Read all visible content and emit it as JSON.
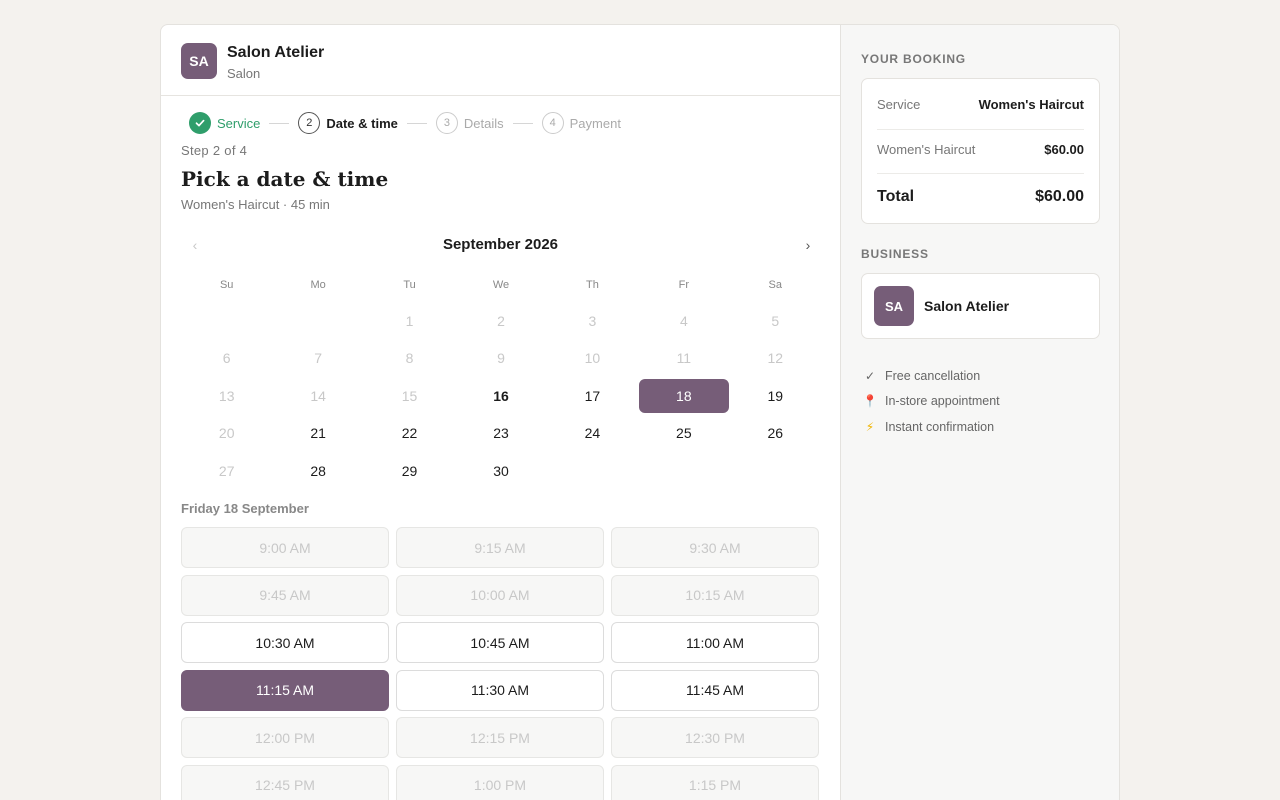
{
  "business": {
    "initials": "SA",
    "name": "Salon Atelier",
    "category": "Salon"
  },
  "stepper": {
    "steps": [
      {
        "number": "",
        "label": "Service",
        "status": "done"
      },
      {
        "number": "2",
        "label": "Date & time",
        "status": "active"
      },
      {
        "number": "3",
        "label": "Details",
        "status": "todo"
      },
      {
        "number": "4",
        "label": "Payment",
        "status": "todo"
      }
    ]
  },
  "page": {
    "step_count": "Step 2 of 4",
    "title": "Pick a date & time",
    "subtitle": "Women's Haircut · 45 min"
  },
  "calendar": {
    "month_title": "September 2026",
    "prev_icon": "‹",
    "next_icon": "›",
    "weekdays": [
      "Su",
      "Mo",
      "Tu",
      "We",
      "Th",
      "Fr",
      "Sa"
    ],
    "days": [
      {
        "label": "",
        "state": "empty"
      },
      {
        "label": "",
        "state": "empty"
      },
      {
        "label": "1",
        "state": "past"
      },
      {
        "label": "2",
        "state": "past"
      },
      {
        "label": "3",
        "state": "past"
      },
      {
        "label": "4",
        "state": "past"
      },
      {
        "label": "5",
        "state": "past"
      },
      {
        "label": "6",
        "state": "past"
      },
      {
        "label": "7",
        "state": "past"
      },
      {
        "label": "8",
        "state": "past"
      },
      {
        "label": "9",
        "state": "past"
      },
      {
        "label": "10",
        "state": "past"
      },
      {
        "label": "11",
        "state": "past"
      },
      {
        "label": "12",
        "state": "past"
      },
      {
        "label": "13",
        "state": "past"
      },
      {
        "label": "14",
        "state": "past"
      },
      {
        "label": "15",
        "state": "past"
      },
      {
        "label": "16",
        "state": "today"
      },
      {
        "label": "17",
        "state": "available"
      },
      {
        "label": "18",
        "state": "selected"
      },
      {
        "label": "19",
        "state": "available"
      },
      {
        "label": "20",
        "state": "past"
      },
      {
        "label": "21",
        "state": "available"
      },
      {
        "label": "22",
        "state": "available"
      },
      {
        "label": "23",
        "state": "available"
      },
      {
        "label": "24",
        "state": "available"
      },
      {
        "label": "25",
        "state": "available"
      },
      {
        "label": "26",
        "state": "available"
      },
      {
        "label": "27",
        "state": "past"
      },
      {
        "label": "28",
        "state": "available"
      },
      {
        "label": "29",
        "state": "available"
      },
      {
        "label": "30",
        "state": "available"
      },
      {
        "label": "",
        "state": "empty"
      },
      {
        "label": "",
        "state": "empty"
      },
      {
        "label": "",
        "state": "empty"
      }
    ]
  },
  "slots": {
    "date_label": "Friday 18 September",
    "times": [
      {
        "label": "9:00 AM",
        "state": "unavailable"
      },
      {
        "label": "9:15 AM",
        "state": "unavailable"
      },
      {
        "label": "9:30 AM",
        "state": "unavailable"
      },
      {
        "label": "9:45 AM",
        "state": "unavailable"
      },
      {
        "label": "10:00 AM",
        "state": "unavailable"
      },
      {
        "label": "10:15 AM",
        "state": "unavailable"
      },
      {
        "label": "10:30 AM",
        "state": "available"
      },
      {
        "label": "10:45 AM",
        "state": "available"
      },
      {
        "label": "11:00 AM",
        "state": "available"
      },
      {
        "label": "11:15 AM",
        "state": "selected"
      },
      {
        "label": "11:30 AM",
        "state": "available"
      },
      {
        "label": "11:45 AM",
        "state": "available"
      },
      {
        "label": "12:00 PM",
        "state": "unavailable"
      },
      {
        "label": "12:15 PM",
        "state": "unavailable"
      },
      {
        "label": "12:30 PM",
        "state": "unavailable"
      },
      {
        "label": "12:45 PM",
        "state": "unavailable"
      },
      {
        "label": "1:00 PM",
        "state": "unavailable"
      },
      {
        "label": "1:15 PM",
        "state": "unavailable"
      }
    ]
  },
  "sidebar": {
    "booking_heading": "YOUR BOOKING",
    "service_key": "Service",
    "service_value": "Women's Haircut",
    "line_item_key": "Women's Haircut",
    "line_item_value": "$60.00",
    "total_key": "Total",
    "total_value": "$60.00",
    "business_heading": "BUSINESS",
    "business_initials": "SA",
    "business_name": "Salon Atelier",
    "perks": [
      {
        "icon": "check-icon",
        "glyph": "✓",
        "label": "Free cancellation"
      },
      {
        "icon": "pin-icon",
        "glyph": "📍",
        "label": "In-store appointment"
      },
      {
        "icon": "bolt-icon",
        "glyph": "⚡",
        "label": "Instant confirmation"
      }
    ]
  },
  "colors": {
    "accent": "#765d78",
    "success": "#2f9e6b",
    "page_bg": "#f4f2ee"
  }
}
